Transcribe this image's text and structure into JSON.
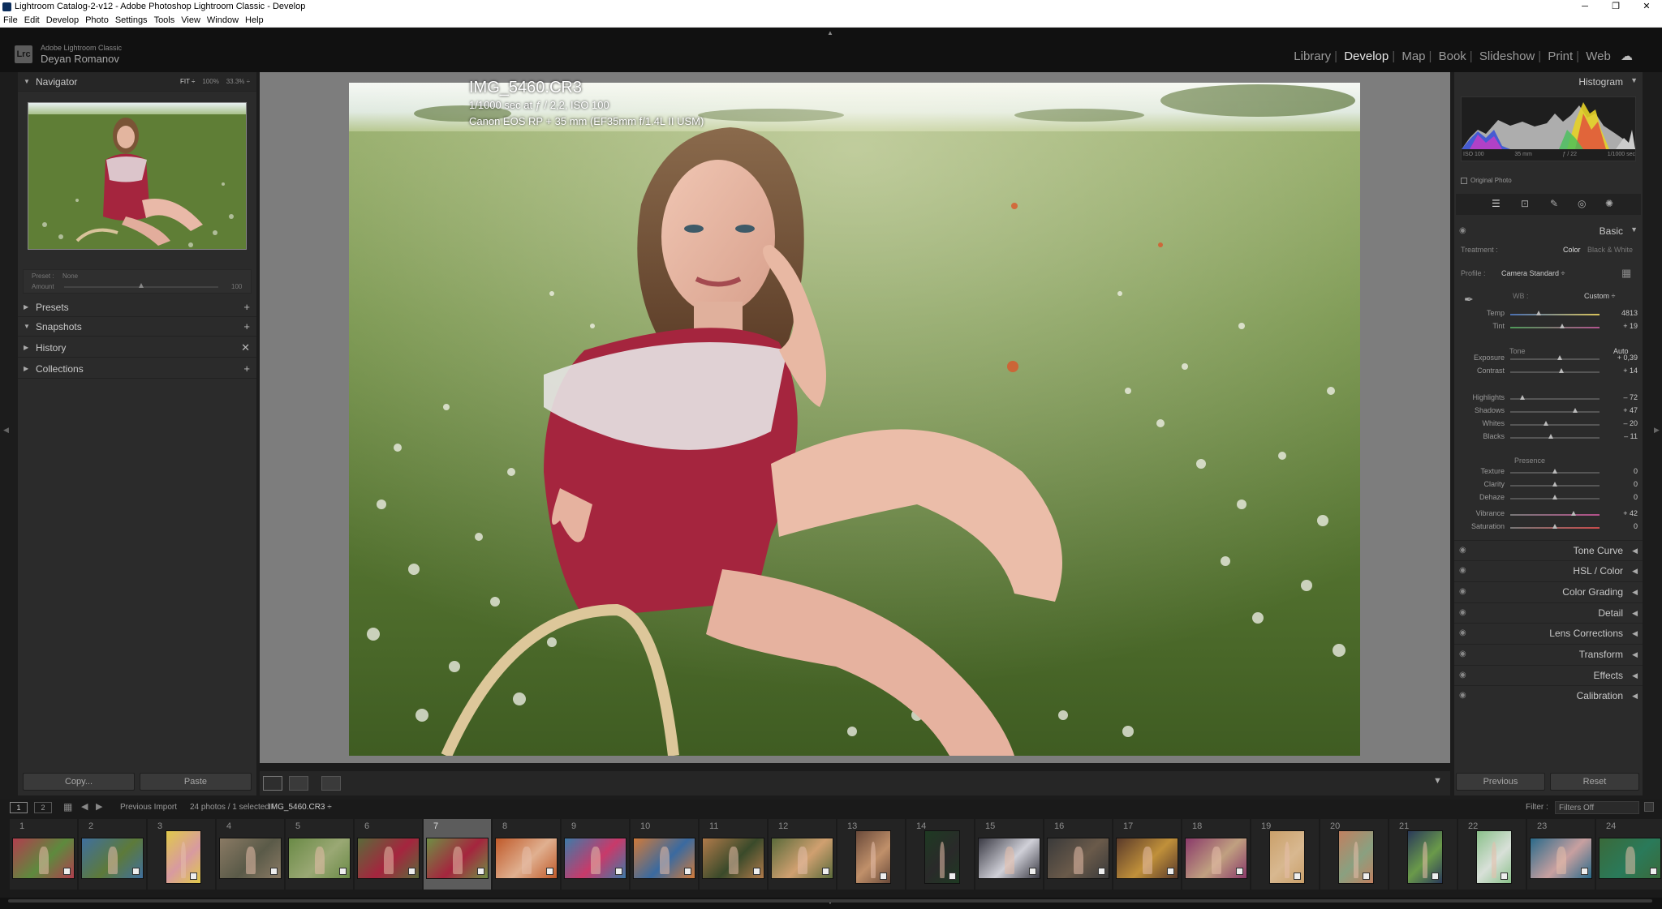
{
  "window": {
    "title": "Lightroom Catalog-2-v12 - Adobe Photoshop Lightroom Classic - Develop",
    "controls": [
      "─",
      "❐",
      "✕"
    ]
  },
  "menu": [
    "File",
    "Edit",
    "Develop",
    "Photo",
    "Settings",
    "Tools",
    "View",
    "Window",
    "Help"
  ],
  "identity": {
    "line1": "Adobe Lightroom Classic",
    "line2": "Deyan Romanov",
    "logo": "Lrc"
  },
  "modules": [
    "Library",
    "Develop",
    "Map",
    "Book",
    "Slideshow",
    "Print",
    "Web"
  ],
  "active_module": "Develop",
  "navigator": {
    "title": "Navigator",
    "opts": [
      "FIT ÷",
      "100%",
      "33.3% ÷"
    ]
  },
  "preset_strip": {
    "preset_label": "Preset :",
    "preset_value": "None",
    "amount_label": "Amount",
    "amount_value": "100"
  },
  "left_panels": [
    "Presets",
    "Snapshots",
    "History",
    "Collections"
  ],
  "left_panel_icons": [
    "+",
    "+",
    "✕",
    "+"
  ],
  "left_buttons": {
    "copy": "Copy...",
    "paste": "Paste"
  },
  "photo_info": {
    "filename": "IMG_5460.CR3",
    "exposure": "1/1000 sec at ƒ / 2,2, ISO 100",
    "camera": "Canon EOS RP + 35 mm (EF35mm f/1.4L II USM)"
  },
  "histogram": {
    "title": "Histogram",
    "meta": [
      "ISO 100",
      "35 mm",
      "ƒ / 22",
      "1/1000 sec"
    ],
    "original_photo": "Original Photo"
  },
  "basic": {
    "title": "Basic",
    "treatment_label": "Treatment :",
    "treatment_color": "Color",
    "treatment_bw": "Black & White",
    "profile_label": "Profile :",
    "profile_value": "Camera Standard ÷",
    "wb_label": "WB :",
    "wb_value": "Custom ÷",
    "tone_label": "Tone",
    "auto": "Auto",
    "presence_label": "Presence",
    "sliders": [
      {
        "label": "Temp",
        "value": "4813",
        "pos": 0.32
      },
      {
        "label": "Tint",
        "value": "+ 19",
        "pos": 0.58
      },
      {
        "label": "Exposure",
        "value": "+ 0,39",
        "pos": 0.55
      },
      {
        "label": "Contrast",
        "value": "+ 14",
        "pos": 0.57
      },
      {
        "label": "Highlights",
        "value": "– 72",
        "pos": 0.14
      },
      {
        "label": "Shadows",
        "value": "+ 47",
        "pos": 0.73
      },
      {
        "label": "Whites",
        "value": "– 20",
        "pos": 0.4
      },
      {
        "label": "Blacks",
        "value": "– 11",
        "pos": 0.45
      },
      {
        "label": "Texture",
        "value": "0",
        "pos": 0.5
      },
      {
        "label": "Clarity",
        "value": "0",
        "pos": 0.5
      },
      {
        "label": "Dehaze",
        "value": "0",
        "pos": 0.5
      },
      {
        "label": "Vibrance",
        "value": "+ 42",
        "pos": 0.71
      },
      {
        "label": "Saturation",
        "value": "0",
        "pos": 0.5
      }
    ]
  },
  "right_panels": [
    "Tone Curve",
    "HSL / Color",
    "Color Grading",
    "Detail",
    "Lens Corrections",
    "Transform",
    "Effects",
    "Calibration"
  ],
  "right_buttons": {
    "previous": "Previous",
    "reset": "Reset"
  },
  "filmbar": {
    "pages": [
      "1",
      "2"
    ],
    "source": "Previous Import",
    "count": "24 photos / 1 selected /",
    "file": "IMG_5460.CR3 ÷",
    "filter_label": "Filter :",
    "filter_value": "Filters Off"
  },
  "film_numbers": [
    "1",
    "2",
    "3",
    "4",
    "5",
    "6",
    "7",
    "8",
    "9",
    "10",
    "11",
    "12",
    "13",
    "14",
    "15",
    "16",
    "17",
    "18",
    "19",
    "20",
    "21",
    "22",
    "23",
    "24"
  ],
  "film_selected_index": 6,
  "colors": {
    "accent_panel": "#2b2b2b",
    "grass": "#6f8e44",
    "dress": "#a5253e"
  }
}
